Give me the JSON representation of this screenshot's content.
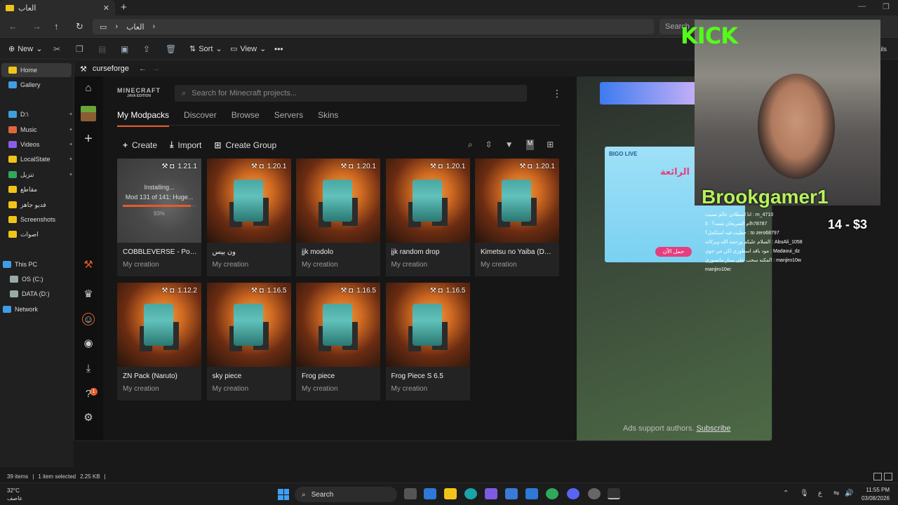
{
  "explorer": {
    "tab_title": "العاب",
    "path_segment": "العاب",
    "search_placeholder": "Search",
    "toolbar": {
      "new": "New",
      "sort": "Sort",
      "view": "View",
      "details": "Details"
    },
    "sidebar": [
      {
        "label": "Home",
        "color": "#f0c419"
      },
      {
        "label": "Gallery",
        "color": "#3e9de6"
      },
      {
        "label": "D:\\",
        "color": "#3ea0d8"
      },
      {
        "label": "Music",
        "color": "#e0663b"
      },
      {
        "label": "Videos",
        "color": "#8a5ee8"
      },
      {
        "label": "LocalState",
        "color": "#f0c419"
      },
      {
        "label": "تنزيل",
        "color": "#2fa95a"
      },
      {
        "label": "مقاطع",
        "color": "#f0c419"
      },
      {
        "label": "فديو جاهز",
        "color": "#f0c419"
      },
      {
        "label": "Screenshots",
        "color": "#f0c419"
      },
      {
        "label": "اصوات",
        "color": "#f0c419"
      },
      {
        "label": "This PC",
        "color": "#3e9de6"
      },
      {
        "label": "OS (C:)",
        "color": "#9aa"
      },
      {
        "label": "DATA (D:)",
        "color": "#9aa"
      },
      {
        "label": "Network",
        "color": "#3e9de6"
      }
    ],
    "status": {
      "items": "39 items",
      "selected": "1 item selected",
      "size": "2.25 KB"
    }
  },
  "curseforge": {
    "app_title": "curseforge",
    "search_placeholder": "Search for Minecraft projects...",
    "logo_top": "MINECRAFT",
    "logo_bottom": "JAVA EDITION",
    "tabs": [
      "My Modpacks",
      "Discover",
      "Browse",
      "Servers",
      "Skins"
    ],
    "actions": {
      "create": "Create",
      "import": "Import",
      "create_group": "Create Group"
    },
    "rail_badge": "1",
    "cards": [
      {
        "name": "COBBLEVERSE - Poke...",
        "sub": "My creation",
        "version": "1.21.1",
        "installing": true,
        "progress": 93
      },
      {
        "name": "ون بيس",
        "sub": "My creation",
        "version": "1.20.1"
      },
      {
        "name": "jjk modolo",
        "sub": "My creation",
        "version": "1.20.1"
      },
      {
        "name": "jjk random drop",
        "sub": "My creation",
        "version": "1.20.1"
      },
      {
        "name": "Kimetsu no Yaiba (Dem...",
        "sub": "My creation",
        "version": "1.20.1"
      },
      {
        "name": "ZN Pack (Naruto)",
        "sub": "My creation",
        "version": "1.12.2"
      },
      {
        "name": "sky piece",
        "sub": "My creation",
        "version": "1.16.5"
      },
      {
        "name": "Frog piece",
        "sub": "My creation",
        "version": "1.16.5"
      },
      {
        "name": "Frog Piece S 6.5",
        "sub": "My creation",
        "version": "1.16.5"
      }
    ],
    "install": {
      "line1": "Installing...",
      "line2": "Mod 131 of 141: Huge...",
      "pct": "93%"
    },
    "ads": {
      "text": "Ads support authors.",
      "link": "Subscribe",
      "bigo_brand": "BIGO LIVE",
      "bigo_headline": "الرائعة",
      "bigo_cta": "حمل الآن"
    }
  },
  "overlay": {
    "kick": "KICK",
    "streamer": "Brookgamer1",
    "goal": "14 - $3",
    "chat": [
      "انا اسطاذن عالم نسيت : m_4710",
      "ام الصريحان شمه؟ : 5h78787",
      "حطيت فيه استكمل؟ : to zero68797",
      "السلام عليكم ورحمة الله وبركاته : AbuAli_1058",
      "مود بافد اسطوري لكن من جوي : Madaoui_dz",
      "المكنه سحب على سنار مانسوري : manjiro10w",
      "manjiro10w:"
    ]
  },
  "taskbar": {
    "temp": "32°C",
    "weather": "عاصف",
    "search": "Search",
    "time": "11:55 PM",
    "date": "03/08/2026",
    "lang": "ع"
  }
}
